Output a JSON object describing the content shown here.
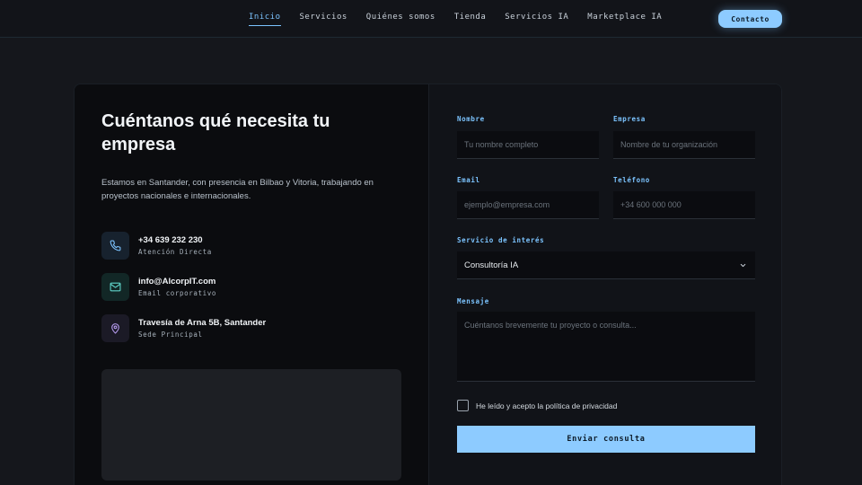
{
  "nav": {
    "links": [
      "Inicio",
      "Servicios",
      "Quiénes somos",
      "Tienda",
      "Servicios IA",
      "Marketplace IA"
    ],
    "active_index": 0,
    "cta_label": "Contacto"
  },
  "contact": {
    "heading": "Cuéntanos qué necesita tu empresa",
    "description": "Estamos en Santander, con presencia en Bilbao y Vitoria, trabajando en proyectos nacionales e internacionales.",
    "items": [
      {
        "title": "+34 639 232 230",
        "subtitle": "Atención Directa",
        "icon": "phone-icon"
      },
      {
        "title": "info@AlcorpIT.com",
        "subtitle": "Email corporativo",
        "icon": "mail-icon"
      },
      {
        "title": "Travesía de Arna 5B, Santander",
        "subtitle": "Sede Principal",
        "icon": "map-pin-icon"
      }
    ]
  },
  "form": {
    "name": {
      "label": "Nombre",
      "placeholder": "Tu nombre completo"
    },
    "company": {
      "label": "Empresa",
      "placeholder": "Nombre de tu organización"
    },
    "email": {
      "label": "Email",
      "placeholder": "ejemplo@empresa.com"
    },
    "phone": {
      "label": "Teléfono",
      "placeholder": "+34 600 000 000"
    },
    "service": {
      "label": "Servicio de interés",
      "value": "Consultoría IA"
    },
    "message": {
      "label": "Mensaje",
      "placeholder": "Cuéntanos brevemente tu proyecto o consulta..."
    },
    "privacy_label": "He leído y acepto la política de privacidad",
    "privacy_checked": false,
    "submit_label": "Enviar consulta"
  },
  "colors": {
    "accent": "#7cc4ff",
    "button": "#8dcbff",
    "background": "#15171c"
  }
}
